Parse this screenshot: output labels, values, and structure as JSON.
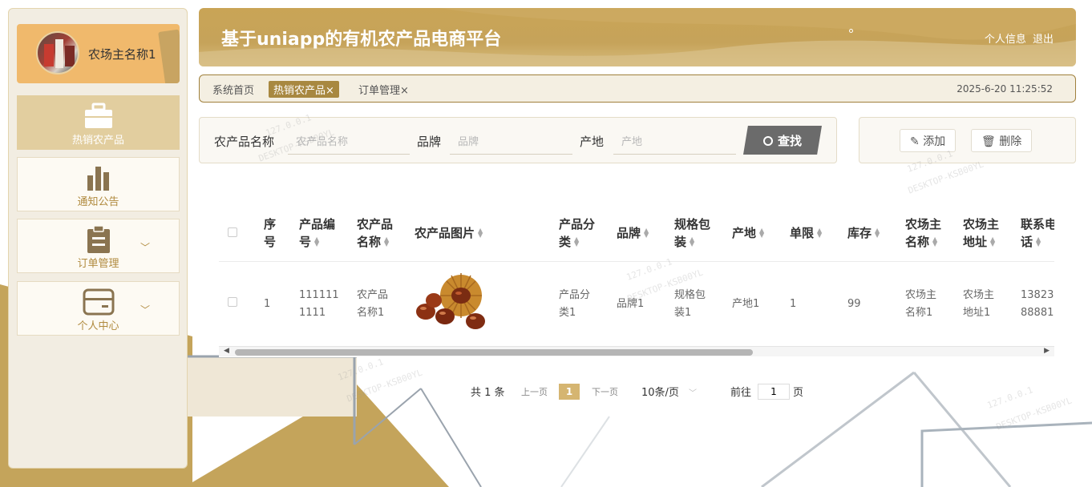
{
  "header": {
    "title": "基于uniapp的有机农产品电商平台",
    "profile_link": "个人信息",
    "logout_link": "退出"
  },
  "sidebar": {
    "user_name": "农场主名称1",
    "items": [
      {
        "label": "热销农产品",
        "icon": "briefcase-icon"
      },
      {
        "label": "通知公告",
        "icon": "bar-chart-icon"
      },
      {
        "label": "订单管理",
        "icon": "clipboard-icon"
      },
      {
        "label": "个人中心",
        "icon": "card-icon"
      }
    ]
  },
  "tabs": {
    "home": "系统首页",
    "active": "热销农产品",
    "orders": "订单管理",
    "close_glyph": "×",
    "datetime": "2025-6-20 11:25:52"
  },
  "search": {
    "name_label": "农产品名称",
    "name_placeholder": "农产品名称",
    "brand_label": "品牌",
    "brand_placeholder": "品牌",
    "origin_label": "产地",
    "origin_placeholder": "产地",
    "search_button": "查找"
  },
  "actions": {
    "add": "添加",
    "delete": "删除"
  },
  "table": {
    "headers": [
      "序号",
      "产品编号",
      "农产品名称",
      "农产品图片",
      "产品分类",
      "品牌",
      "规格包装",
      "产地",
      "单限",
      "库存",
      "农场主名称",
      "农场主地址",
      "联系电话"
    ],
    "header_lines": [
      [
        "序",
        "号"
      ],
      [
        "产品编",
        "号"
      ],
      [
        "农产品",
        "名称"
      ],
      [
        "农产品图片",
        ""
      ],
      [
        "产品分",
        "类"
      ],
      [
        "品牌",
        ""
      ],
      [
        "规格包",
        "装"
      ],
      [
        "产地",
        ""
      ],
      [
        "单限",
        ""
      ],
      [
        "库存",
        ""
      ],
      [
        "农场主",
        "名称"
      ],
      [
        "农场主",
        "地址"
      ],
      [
        "联系电",
        "话"
      ]
    ],
    "rows": [
      {
        "index": "1",
        "code": [
          "111111",
          "1111"
        ],
        "name": [
          "农产品",
          "名称1"
        ],
        "category": [
          "产品分",
          "类1"
        ],
        "brand": "品牌1",
        "spec": [
          "规格包",
          "装1"
        ],
        "origin": "产地1",
        "limit": "1",
        "stock": "99",
        "farmer_name": [
          "农场主",
          "名称1"
        ],
        "farmer_addr": [
          "农场主",
          "地址1"
        ],
        "phone": [
          "13823",
          "88881"
        ]
      }
    ]
  },
  "pagination": {
    "total": "共 1 条",
    "prev": "上一页",
    "current": "1",
    "next": "下一页",
    "page_size": "10条/页",
    "goto_label": "前往",
    "goto_value": "1",
    "page_unit": "页"
  },
  "colors": {
    "accent": "#c6a35a",
    "accent_dark": "#a88840",
    "sidebar_bg": "#f2ede2"
  }
}
